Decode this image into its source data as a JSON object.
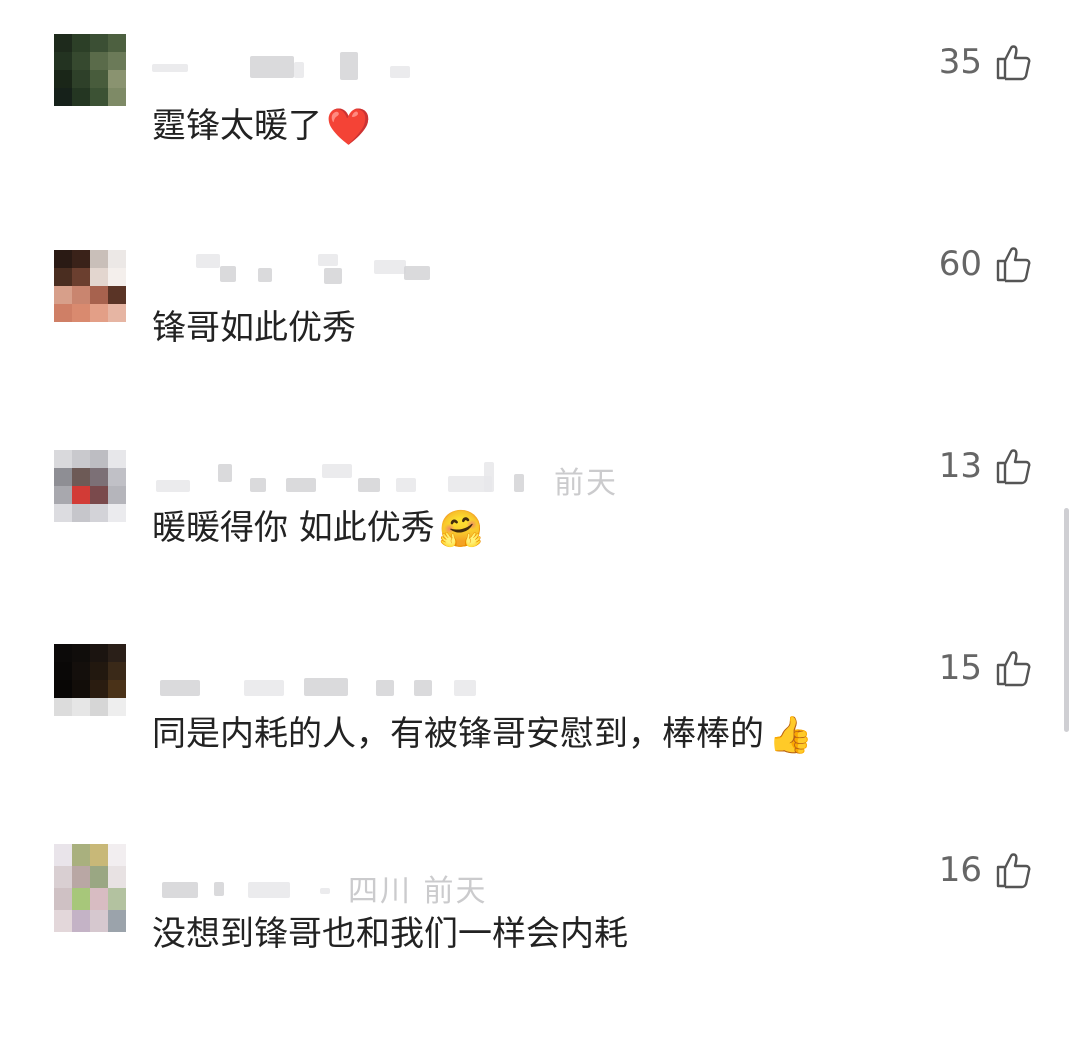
{
  "comments": [
    {
      "likes": "35",
      "text": "霆锋太暖了",
      "emoji": "❤️",
      "meta": ""
    },
    {
      "likes": "60",
      "text": "锋哥如此优秀",
      "emoji": "",
      "meta": ""
    },
    {
      "likes": "13",
      "text": "暖暖得你 如此优秀",
      "emoji": "🤗",
      "meta": "前天"
    },
    {
      "likes": "15",
      "text": "同是内耗的人，有被锋哥安慰到，棒棒的",
      "emoji": "👍",
      "meta": ""
    },
    {
      "likes": "16",
      "text": "没想到锋哥也和我们一样会内耗",
      "emoji": "",
      "meta": "四川 前天"
    }
  ],
  "icons": {
    "like": "thumbs-up-icon",
    "avatar": "blurred-avatar"
  },
  "colors": {
    "text": "#222222",
    "likes": "#666666",
    "meta": "#c6c6c8"
  }
}
